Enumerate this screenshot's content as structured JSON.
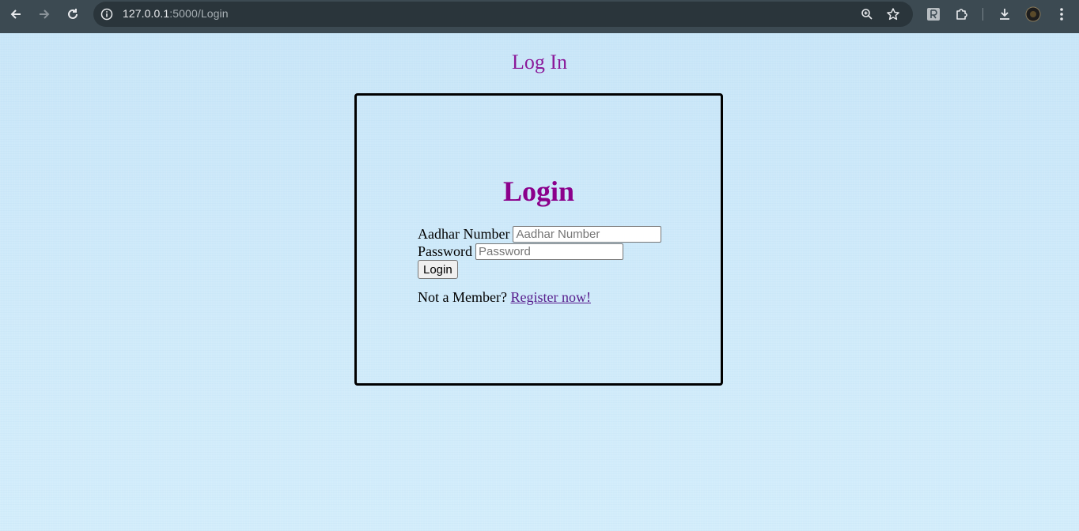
{
  "browser": {
    "url_host": "127.0.0.1",
    "url_path": ":5000/Login"
  },
  "page": {
    "title": "Log In"
  },
  "form": {
    "heading": "Login",
    "aadhar_label": "Aadhar Number",
    "aadhar_placeholder": "Aadhar Number",
    "aadhar_value": "",
    "password_label": "Password",
    "password_placeholder": "Password",
    "password_value": "",
    "submit_label": "Login",
    "member_text": "Not a Member?",
    "register_link": "Register now!"
  },
  "colors": {
    "title": "#8b1a9a",
    "heading": "#8b008b",
    "link": "#551a8b"
  }
}
